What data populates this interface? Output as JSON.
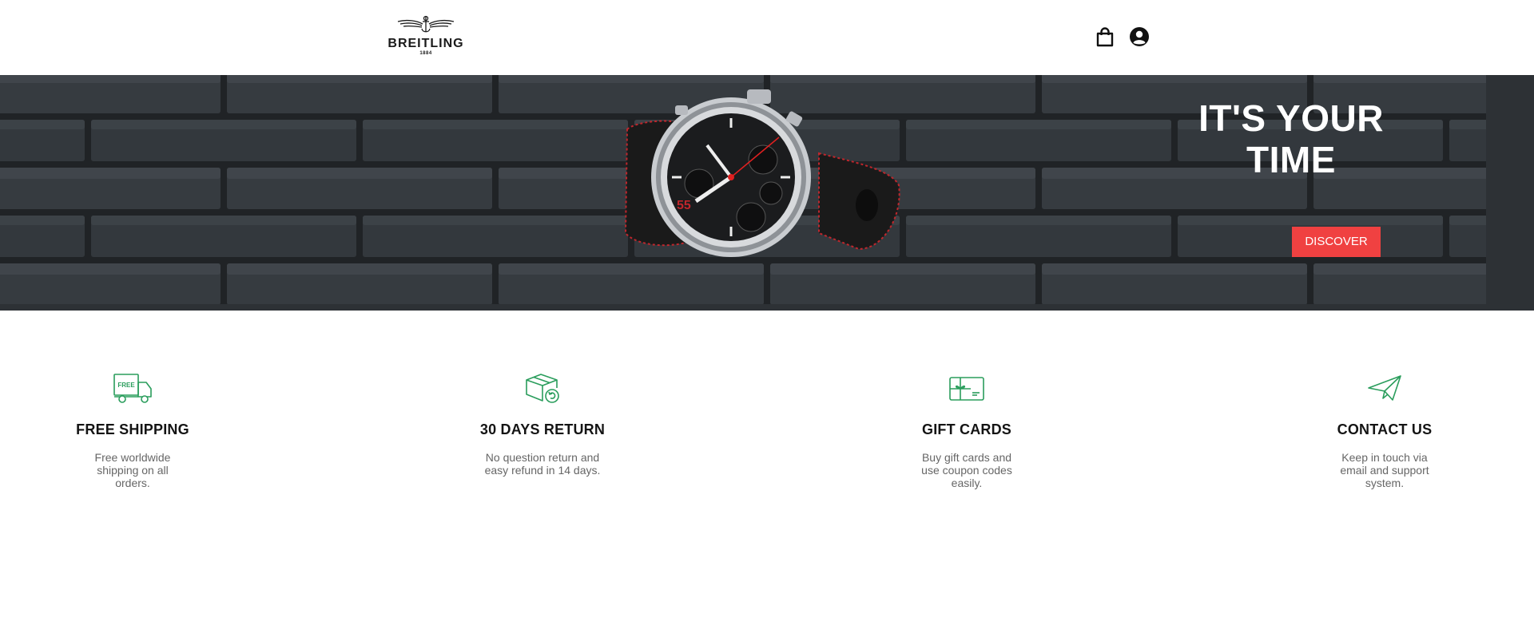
{
  "header": {
    "brand": "BREITLING",
    "brand_year": "1884",
    "icons": [
      "shopping-bag-icon",
      "user-account-icon"
    ]
  },
  "hero": {
    "title": "IT'S YOUR TIME",
    "button_label": "DISCOVER",
    "accent_color": "#f04141"
  },
  "features": [
    {
      "icon": "free-shipping-truck-icon",
      "icon_text": "FREE",
      "title": "FREE SHIPPING",
      "text": "Free worldwide shipping on all orders."
    },
    {
      "icon": "return-box-icon",
      "title": "30 DAYS RETURN",
      "text": "No question return and easy refund in 14 days."
    },
    {
      "icon": "gift-card-icon",
      "title": "GIFT CARDS",
      "text": "Buy gift cards and use coupon codes easily."
    },
    {
      "icon": "paper-plane-icon",
      "title": "CONTACT US",
      "text": "Keep in touch via email and support system."
    }
  ],
  "colors": {
    "icon_green": "#2a9d5c",
    "text_dark": "#141414",
    "text_muted": "#666666"
  }
}
